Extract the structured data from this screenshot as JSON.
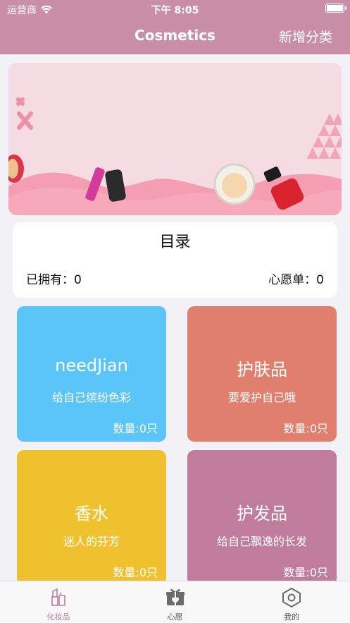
{
  "status_bar": {
    "carrier": "运营商",
    "time": "下午 8:05"
  },
  "nav": {
    "title": "Cosmetics",
    "right_action": "新增分类"
  },
  "catalog": {
    "title": "目录",
    "owned_label": "已拥有：",
    "owned_value": "0",
    "wishlist_label": "心愿单：",
    "wishlist_value": "0"
  },
  "categories": [
    {
      "name": "needJian",
      "subtitle": "给自己缤纷色彩",
      "count": "数量:0只",
      "color": "#5cc5f7"
    },
    {
      "name": "护肤品",
      "subtitle": "要爱护自己哦",
      "count": "数量:0只",
      "color": "#e07f6d"
    },
    {
      "name": "香水",
      "subtitle": "迷人的芬芳",
      "count": "数量:0只",
      "color": "#f0c12e"
    },
    {
      "name": "护发品",
      "subtitle": "给自己飘逸的长发",
      "count": "数量:0只",
      "color": "#c07c9d"
    }
  ],
  "tabs": [
    {
      "label": "化妆品",
      "icon": "lipstick-icon",
      "active": true
    },
    {
      "label": "心愿",
      "icon": "gift-icon",
      "active": false
    },
    {
      "label": "我的",
      "icon": "hexagon-settings-icon",
      "active": false
    }
  ],
  "colors": {
    "nav_bg": "#c98fa9",
    "accent": "#c07c9d",
    "banner_bg": "#f5dbe2"
  }
}
